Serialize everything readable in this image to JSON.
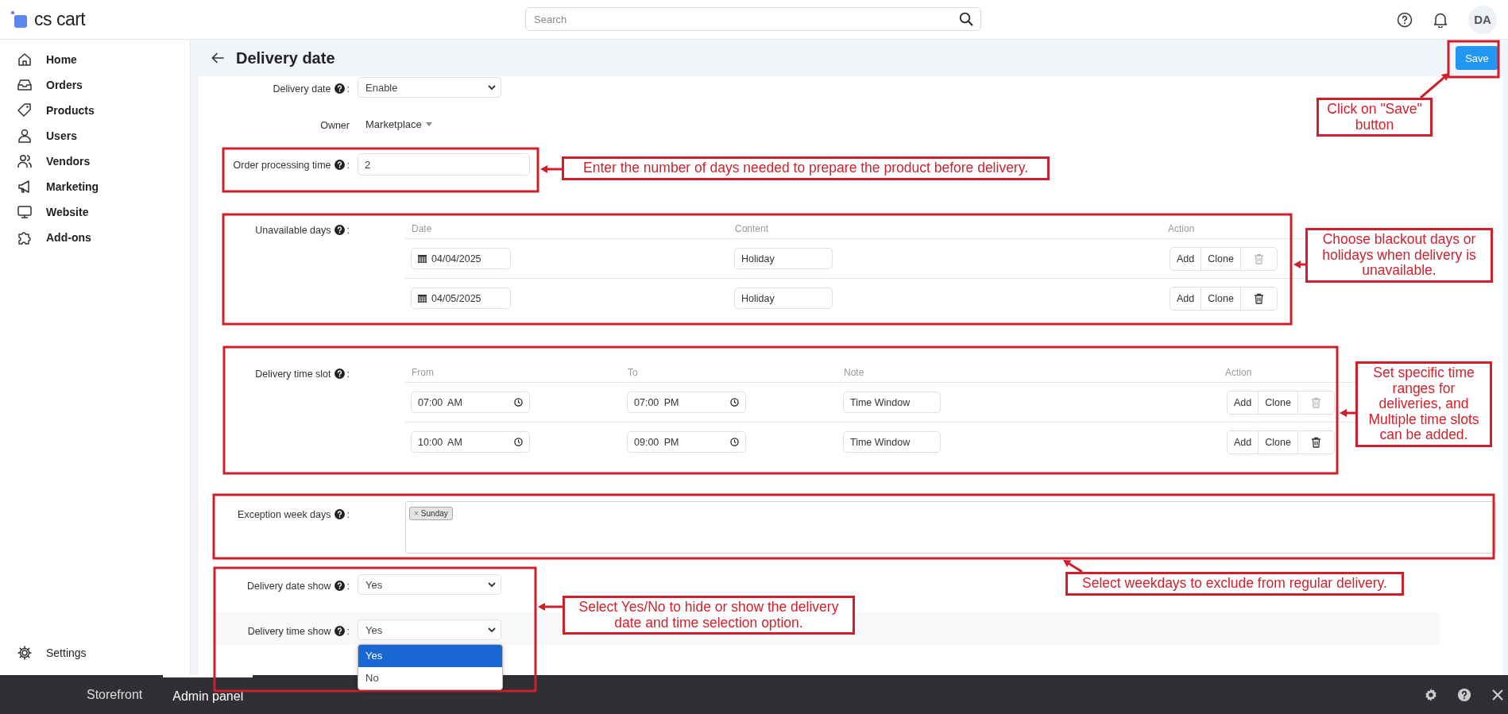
{
  "brand": {
    "name": "cs cart"
  },
  "search": {
    "placeholder": "Search"
  },
  "user": {
    "initials": "DA"
  },
  "sidebar": {
    "items": [
      {
        "label": "Home"
      },
      {
        "label": "Orders"
      },
      {
        "label": "Products"
      },
      {
        "label": "Users"
      },
      {
        "label": "Vendors"
      },
      {
        "label": "Marketing"
      },
      {
        "label": "Website"
      },
      {
        "label": "Add-ons"
      }
    ],
    "footer": [
      {
        "label": "Settings"
      }
    ]
  },
  "page": {
    "title": "Delivery date",
    "save_button": "Save"
  },
  "form": {
    "fields": [
      {
        "kind": "select",
        "label": "Delivery date",
        "help": true,
        "suffix": ":",
        "value": "Enable",
        "hovered": false
      },
      {
        "kind": "owner",
        "label": "Owner",
        "help": false,
        "value": "Marketplace",
        "hovered": false
      },
      {
        "kind": "text",
        "label": "Order processing time",
        "help": true,
        "suffix": ":",
        "value": "2",
        "hovered": false
      },
      {
        "kind": "table",
        "label": "Unavailable days",
        "help": true,
        "suffix": ":",
        "hovered": false,
        "columns": [
          "Date",
          "Content",
          "Action"
        ],
        "rows": [
          {
            "cells": [
              {
                "kind": "date",
                "value": "04/04/2025"
              },
              {
                "kind": "text",
                "value": "Holiday"
              }
            ],
            "actions": [
              "Add",
              "Clone"
            ],
            "delete_disabled": true
          },
          {
            "cells": [
              {
                "kind": "date",
                "value": "04/05/2025"
              },
              {
                "kind": "text",
                "value": "Holiday"
              }
            ],
            "actions": [
              "Add",
              "Clone"
            ],
            "delete_disabled": false
          }
        ]
      },
      {
        "kind": "table",
        "label": "Delivery time slot",
        "help": true,
        "suffix": ":",
        "hovered": false,
        "columns": [
          "From",
          "To",
          "Note",
          "Action"
        ],
        "rows": [
          {
            "cells": [
              {
                "kind": "time",
                "value": "07:00 AM"
              },
              {
                "kind": "time",
                "value": "07:00 PM"
              },
              {
                "kind": "text",
                "value": "Time Window"
              }
            ],
            "actions": [
              "Add",
              "Clone"
            ],
            "delete_disabled": true
          },
          {
            "cells": [
              {
                "kind": "time",
                "value": "10:00 AM"
              },
              {
                "kind": "time",
                "value": "09:00 PM"
              },
              {
                "kind": "text",
                "value": "Time Window"
              }
            ],
            "actions": [
              "Add",
              "Clone"
            ],
            "delete_disabled": false
          }
        ]
      },
      {
        "kind": "tags",
        "label": "Exception week days",
        "help": true,
        "suffix": ":",
        "hovered": false,
        "tags": [
          {
            "label": "Sunday",
            "remove": "×"
          }
        ]
      },
      {
        "kind": "select",
        "label": "Delivery date show",
        "help": true,
        "suffix": ":",
        "value": "Yes",
        "hovered": false
      },
      {
        "kind": "select",
        "label": "Delivery time show",
        "help": true,
        "suffix": ":",
        "value": "Yes",
        "hovered": true,
        "open": true,
        "options": [
          {
            "label": "Yes",
            "selected": true
          },
          {
            "label": "No",
            "selected": false
          }
        ]
      }
    ]
  },
  "bottom_bar": {
    "tabs": [
      {
        "label": "Storefront",
        "selected": false
      },
      {
        "label": "Admin panel",
        "selected": true
      }
    ]
  },
  "annotations": [
    {
      "kind": "frame"
    },
    {
      "kind": "callout",
      "text": "Click on \"Save\" button"
    },
    {
      "kind": "frame"
    },
    {
      "kind": "callout",
      "text": "Enter the number of days needed to prepare the product before delivery."
    },
    {
      "kind": "frame"
    },
    {
      "kind": "callout",
      "text": "Choose blackout days or holidays when delivery is unavailable."
    },
    {
      "kind": "frame"
    },
    {
      "kind": "callout",
      "text": "Set specific time ranges for deliveries, and Multiple time slots can be added."
    },
    {
      "kind": "frame"
    },
    {
      "kind": "callout",
      "text": "Select weekdays to exclude from regular delivery."
    },
    {
      "kind": "frame"
    },
    {
      "kind": "callout",
      "text": "Select Yes/No to hide or show the delivery date and time selection option."
    }
  ]
}
